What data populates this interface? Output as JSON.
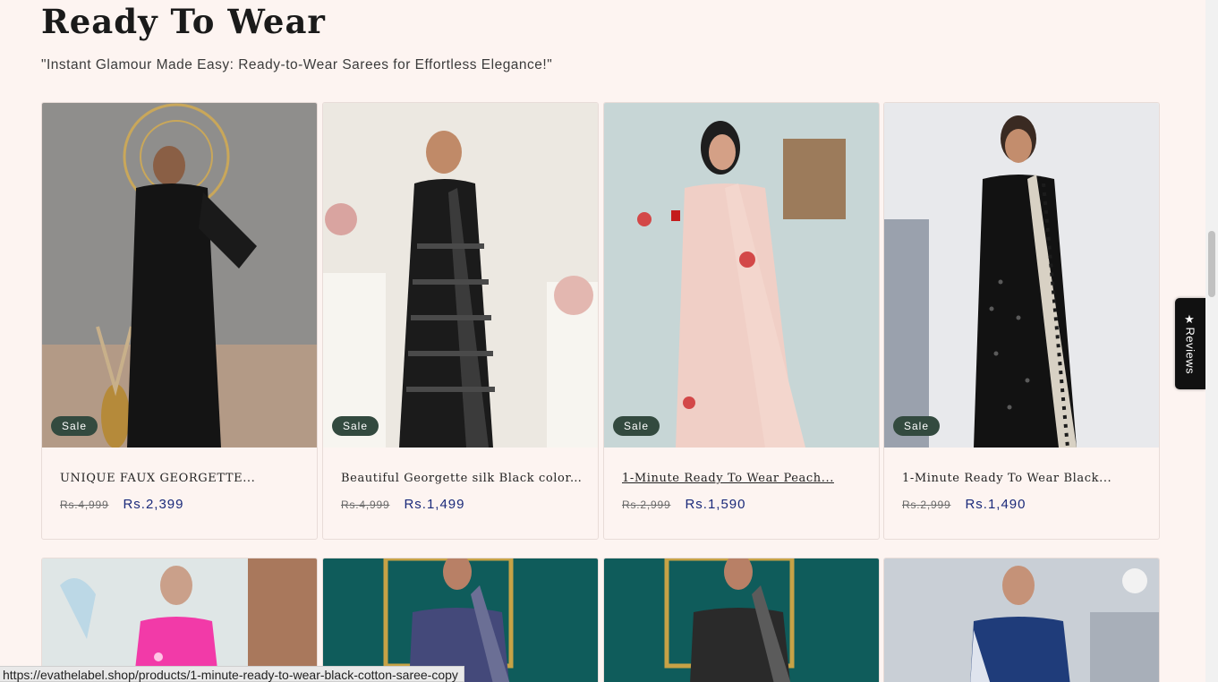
{
  "section": {
    "title": "Ready To Wear",
    "subtitle": "\"Instant Glamour Made Easy: Ready-to-Wear Sarees for Effortless Elegance!\""
  },
  "products": [
    {
      "name": "UNIQUE FAUX GEORGETTE...",
      "badge": "Sale",
      "old_price": "Rs.4,999",
      "price": "Rs.2,399"
    },
    {
      "name": "Beautiful Georgette silk Black color...",
      "badge": "Sale",
      "old_price": "Rs.4,999",
      "price": "Rs.1,499"
    },
    {
      "name": "1-Minute Ready To Wear Peach...",
      "badge": "Sale",
      "old_price": "Rs.2,999",
      "price": "Rs.1,590"
    },
    {
      "name": "1-Minute Ready To Wear Black...",
      "badge": "Sale",
      "old_price": "Rs.2,999",
      "price": "Rs.1,490"
    }
  ],
  "reviews_tab": {
    "label": "★Reviews"
  },
  "status_bar": {
    "url": "https://evathelabel.shop/products/1-minute-ready-to-wear-black-cotton-saree-copy"
  },
  "colors": {
    "background": "#fdf4f1",
    "badge": "#334a3f",
    "price": "#1a2a7a"
  }
}
